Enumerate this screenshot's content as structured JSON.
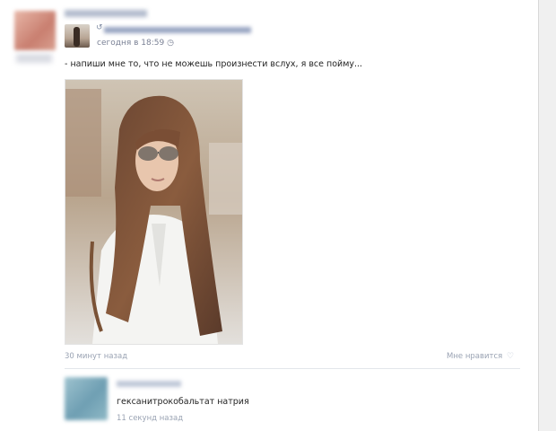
{
  "post": {
    "time": "сегодня в 18:59",
    "time_icon": "clock-icon",
    "text": "- напиши мне то, что не можешь произнести вслух, я все пойму...",
    "repost_glyph": "↺",
    "photo_time": "30 минут назад",
    "like_label": "Мне нравится",
    "like_icon": "heart-icon"
  },
  "comment": {
    "text": "гексанитрокобальтат натрия",
    "time": "11 секунд назад"
  },
  "colors": {
    "link": "#7a8195",
    "meta": "#9aa3b3",
    "text": "#1f1f1f"
  }
}
